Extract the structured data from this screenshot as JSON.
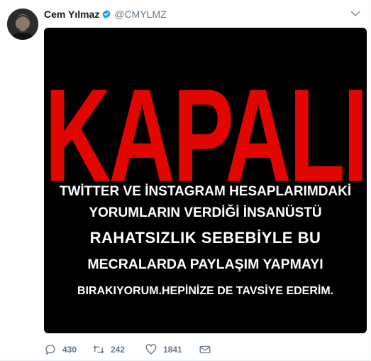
{
  "author": {
    "display_name": "Cem Yılmaz",
    "handle": "@CMYLMZ",
    "verified": true,
    "avatar_icon": "user-avatar"
  },
  "media": {
    "headline": "KAPALI",
    "headline_color": "#e10600",
    "lines": [
      "TWİTTER VE İNSTAGRAM HESAPLARIMDAKİ",
      "YORUMLARIN VERDİĞİ İNSANÜSTÜ",
      "RAHATSIZLIK SEBEBİYLE BU",
      "MECRALARDA PAYLAŞIM YAPMAYI",
      "BIRAKIYORUM.HEPİNİZE DE TAVSİYE EDERİM."
    ],
    "background": "#000000"
  },
  "actions": {
    "reply_count": "430",
    "retweet_count": "242",
    "like_count": "1841",
    "icons": [
      "reply-icon",
      "retweet-icon",
      "like-icon",
      "message-icon"
    ]
  },
  "colors": {
    "verified_blue": "#1da1f2",
    "secondary_text": "#657786"
  }
}
